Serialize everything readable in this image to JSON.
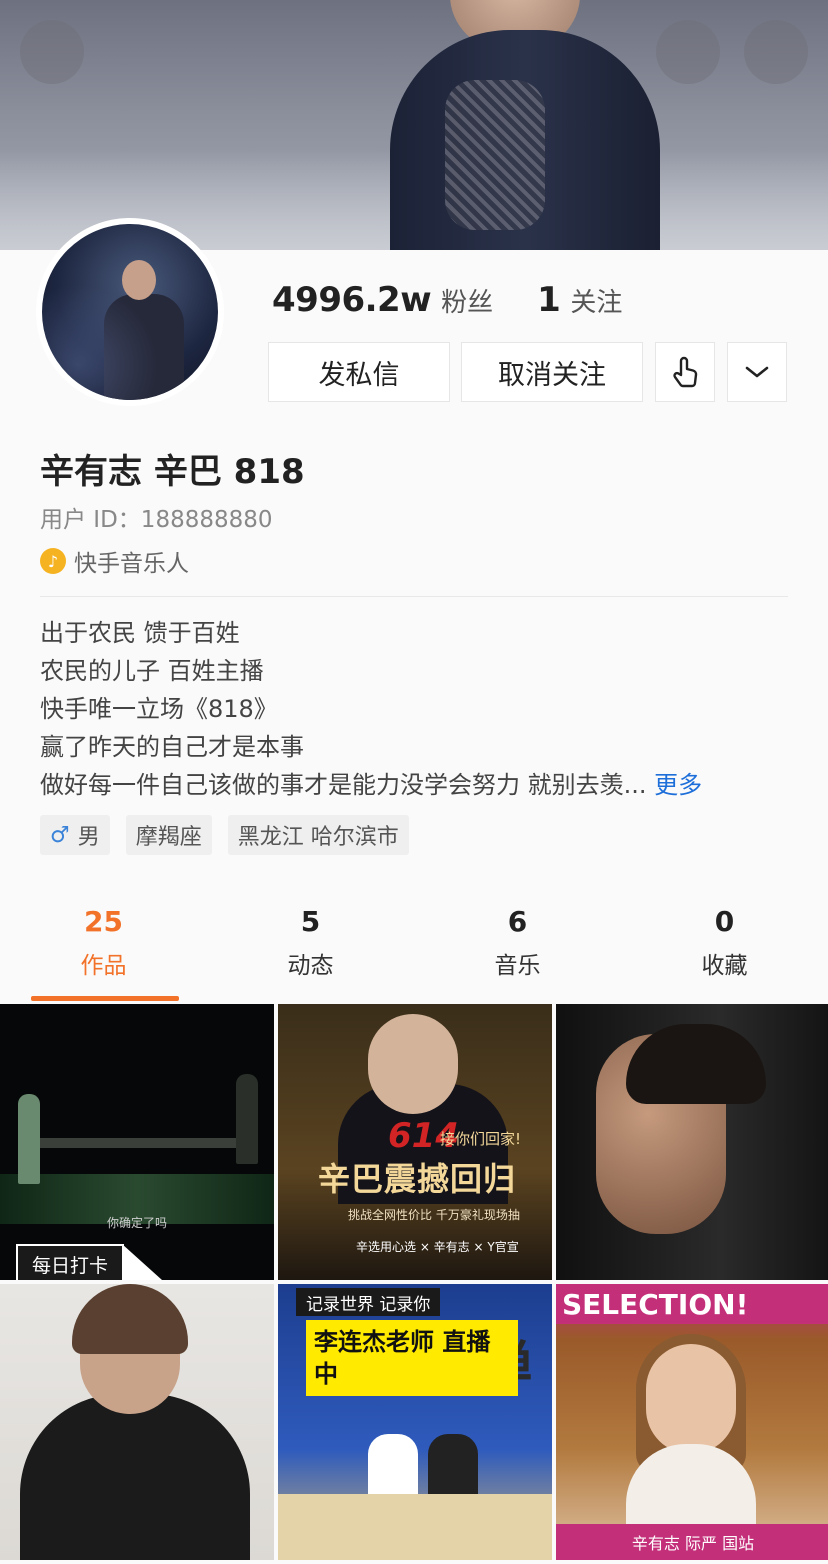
{
  "stats": {
    "followers_count": "4996.2w",
    "followers_label": "粉丝",
    "following_count": "1",
    "following_label": "关注"
  },
  "actions": {
    "message_label": "发私信",
    "unfollow_label": "取消关注",
    "poke_icon": "hand-tap-icon",
    "more_icon": "chevron-down-icon"
  },
  "profile": {
    "name": "辛有志 辛巴 818",
    "user_id": "用户 ID：188888880",
    "tagline": "快手音乐人",
    "bio_lines": [
      "出于农民 馈于百姓",
      "农民的儿子  百姓主播",
      "快手唯一立场《818》",
      "赢了昨天的自己才是本事",
      "做好每一件自己该做的事才是能力没学会努力  就别去羡..."
    ],
    "bio_more": "更多",
    "gender_symbol": "♂",
    "gender": "男",
    "zodiac": "摩羯座",
    "location": "黑龙江 哈尔滨市"
  },
  "tabs": [
    {
      "count": "25",
      "label": "作品",
      "active": true
    },
    {
      "count": "5",
      "label": "动态",
      "active": false
    },
    {
      "count": "6",
      "label": "音乐",
      "active": false
    },
    {
      "count": "0",
      "label": "收藏",
      "active": false
    }
  ],
  "grid": {
    "t1_subtitle": "你确定了吗",
    "t1_badge": "每日打卡",
    "t2_number": "614",
    "t2_home": "接你们回家!",
    "t2_title": "辛巴震撼回归",
    "t2_bar": "挑战全网性价比   千万豪礼现场抽",
    "t2_foot": "辛选用心选 × 辛有志 × Y官宣",
    "t5_tag": "记录世界 记录你",
    "t5_yellow": "李连杰老师 直播中",
    "t5_calli": "极禅",
    "t6_header": "SELECTION!",
    "t6_bottom": "辛有志    际严      国站"
  },
  "colors": {
    "accent": "#f2722a",
    "link": "#1e6fd9",
    "music_badge": "#f5b321"
  }
}
